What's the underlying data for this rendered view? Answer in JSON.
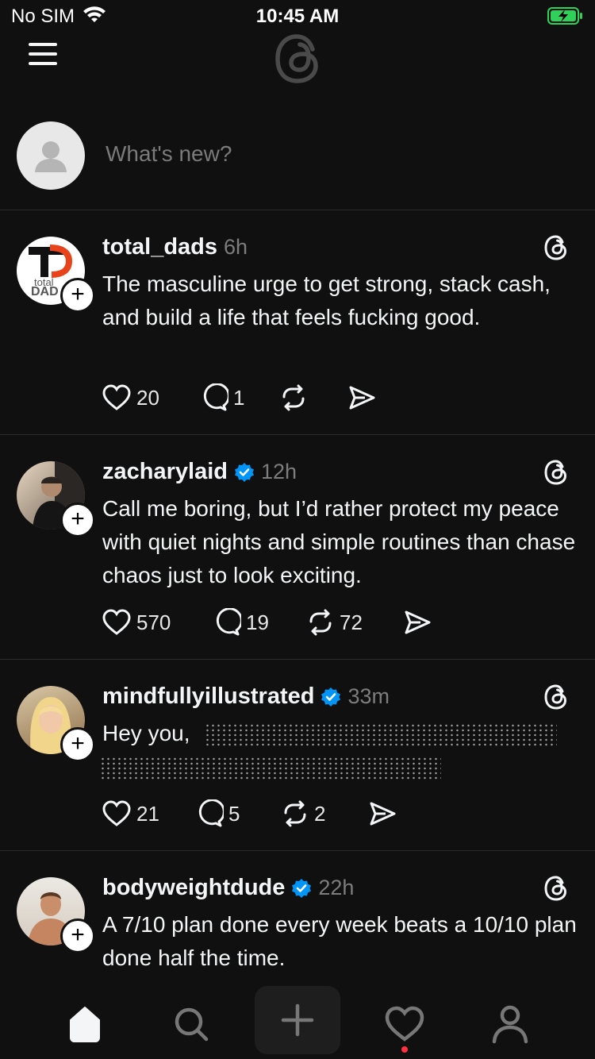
{
  "status_bar": {
    "carrier": "No SIM",
    "time": "10:45 AM"
  },
  "composer": {
    "placeholder": "What's new?"
  },
  "posts": [
    {
      "username": "total_dads",
      "time": "6h",
      "verified": false,
      "avatar_text": [
        "total",
        "DAD"
      ],
      "text": "The masculine urge to get strong, stack cash, and build a life that feels fucking good.",
      "likes": "20",
      "replies": "1",
      "reposts": ""
    },
    {
      "username": "zacharylaid",
      "time": "12h",
      "verified": true,
      "text": "Call me boring, but I’d rather protect my peace with quiet nights and simple routines than chase chaos just to look exciting.",
      "likes": "570",
      "replies": "19",
      "reposts": "72"
    },
    {
      "username": "mindfullyillustrated",
      "time": "33m",
      "verified": true,
      "text": "Hey you,",
      "likes": "21",
      "replies": "5",
      "reposts": "2"
    },
    {
      "username": "bodyweightdude",
      "time": "22h",
      "verified": true,
      "text": "A 7/10 plan done every week beats a 10/10 plan done half the time."
    }
  ],
  "colors": {
    "background": "#101010",
    "verified": "#0095f6",
    "notification_dot": "#ff3040"
  },
  "icons": [
    "menu-icon",
    "threads-logo-icon",
    "heart-icon",
    "comment-icon",
    "repost-icon",
    "share-icon",
    "home-icon",
    "search-icon",
    "plus-icon",
    "person-icon"
  ]
}
